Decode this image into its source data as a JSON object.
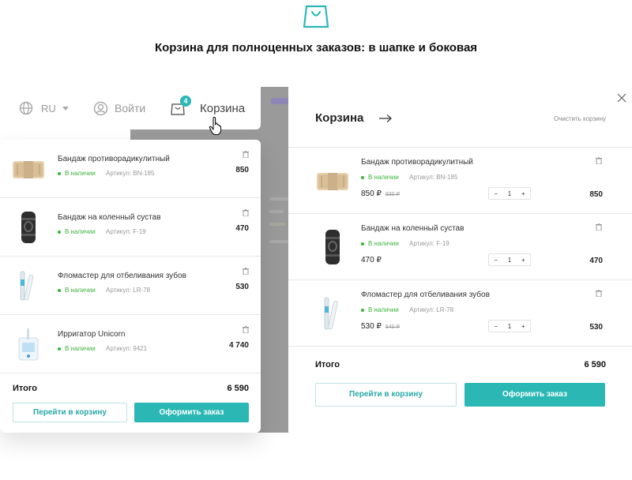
{
  "header": {
    "title": "Корзина для полноценных заказов: в шапке и боковая",
    "bag_icon": "shopping-bag-icon"
  },
  "topbar": {
    "lang": "RU",
    "login": "Войти",
    "cart_label": "Корзина",
    "cart_count": "4"
  },
  "dropdown": {
    "items": [
      {
        "name": "Бандаж противорадикулитный",
        "stock": "В наличии",
        "article": "Артикул: BN-185",
        "price": "850",
        "image": "belt-bandage"
      },
      {
        "name": "Бандаж на коленный сустав",
        "stock": "В наличии",
        "article": "Артикул: F-19",
        "price": "470",
        "image": "knee-brace"
      },
      {
        "name": "Фломастер для отбеливания зубов",
        "stock": "В наличии",
        "article": "Артикул: LR-78",
        "price": "530",
        "image": "whitening-pen"
      },
      {
        "name": "Ирригатор Unicorn",
        "stock": "В наличии",
        "article": "Артикул: 9421",
        "price": "4 740",
        "image": "irrigator"
      }
    ],
    "total_label": "Итого",
    "total_value": "6 590",
    "go_to_cart": "Перейти в корзину",
    "checkout": "Оформить заказ"
  },
  "side_cart": {
    "title": "Корзина",
    "clear": "Очистить корзину",
    "items": [
      {
        "name": "Бандаж противорадикулитный",
        "stock": "В наличии",
        "article": "Артикул: BN-185",
        "price": "850 ₽",
        "old_price": "930 ₽",
        "qty": "1",
        "sum": "850"
      },
      {
        "name": "Бандаж на коленный сустав",
        "stock": "В наличии",
        "article": "Артикул: F-19",
        "price": "470 ₽",
        "old_price": "",
        "qty": "1",
        "sum": "470"
      },
      {
        "name": "Фломастер для отбеливания зубов",
        "stock": "В наличии",
        "article": "Артикул: LR-78",
        "price": "530 ₽",
        "old_price": "640 ₽",
        "qty": "1",
        "sum": "530"
      }
    ],
    "minus": "−",
    "plus": "+",
    "total_label": "Итого",
    "total_value": "6 590",
    "go_to_cart": "Перейти в корзину",
    "checkout": "Оформить заказ"
  },
  "colors": {
    "accent": "#2bb8b5",
    "in_stock": "#3cb43c",
    "overlay": "#9a9a9a"
  }
}
